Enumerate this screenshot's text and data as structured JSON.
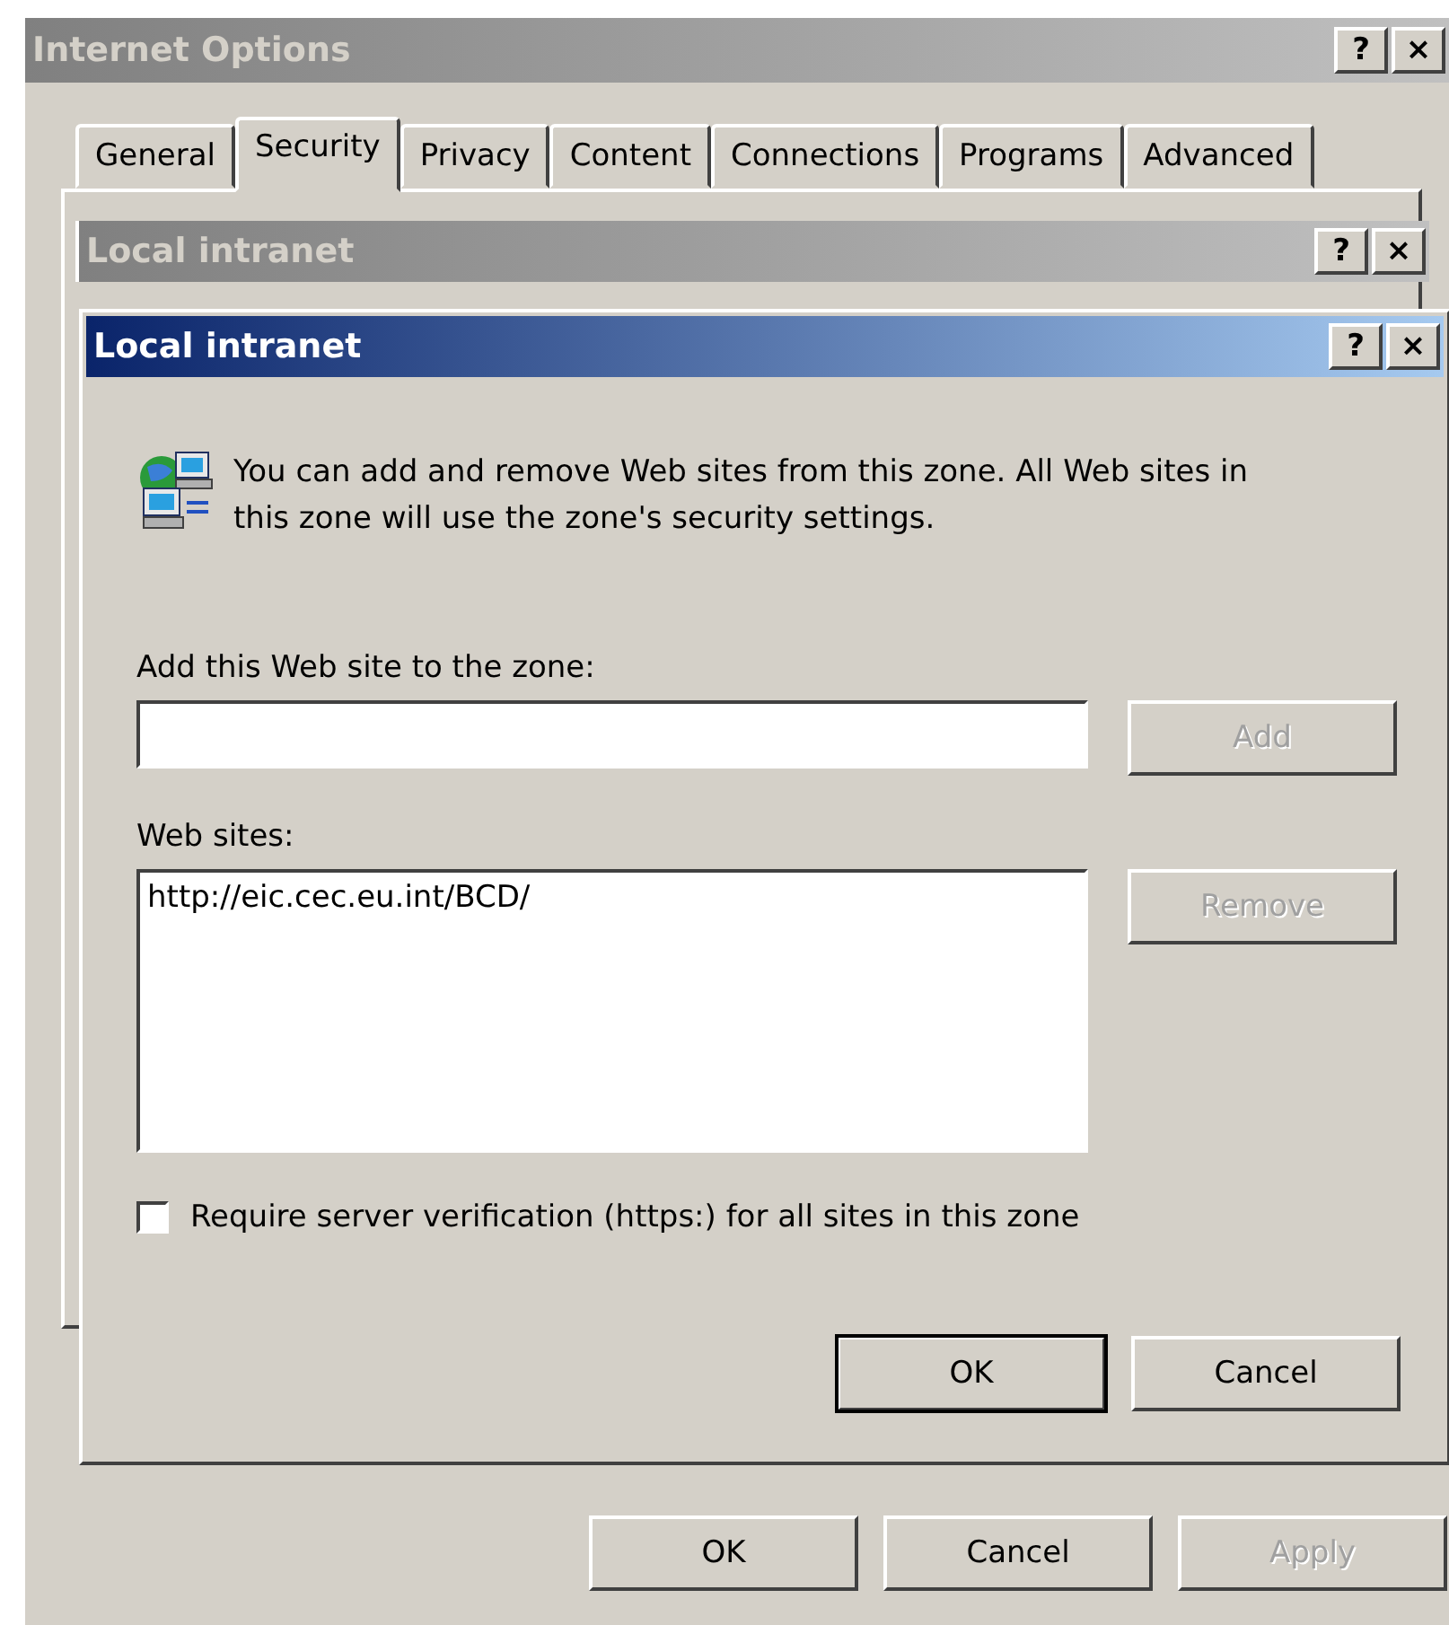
{
  "window": {
    "title": "Internet Options",
    "active": false,
    "controls": [
      "?",
      "×"
    ]
  },
  "tabs": [
    {
      "label": "General",
      "selected": false
    },
    {
      "label": "Security",
      "selected": true
    },
    {
      "label": "Privacy",
      "selected": false
    },
    {
      "label": "Content",
      "selected": false
    },
    {
      "label": "Connections",
      "selected": false
    },
    {
      "label": "Programs",
      "selected": false
    },
    {
      "label": "Advanced",
      "selected": false
    }
  ],
  "back_dialog": {
    "title": "Local intranet",
    "active": false,
    "controls": [
      "?",
      "×"
    ]
  },
  "dialog": {
    "title": "Local intranet",
    "active": true,
    "controls": [
      "?",
      "×"
    ],
    "description": "You can add and remove Web sites from this zone. All Web sites in this zone will use the zone's security settings.",
    "add_label": "Add this Web site to the zone:",
    "add_button": {
      "label": "Add",
      "disabled": true,
      "default": false
    },
    "sites_label": "Web sites:",
    "sites": [
      {
        "text": "http://eic.cec.eu.int/BCD/",
        "selected": false
      }
    ],
    "remove_button": {
      "label": "Remove",
      "disabled": true,
      "default": false
    },
    "checkbox": {
      "label": "Require server verification (https:) for all sites in this zone",
      "checked": false
    },
    "buttons": [
      {
        "label": "OK",
        "disabled": false,
        "default": true
      },
      {
        "label": "Cancel",
        "disabled": false,
        "default": false
      }
    ]
  },
  "buttons": [
    {
      "label": "OK",
      "disabled": false,
      "default": false
    },
    {
      "label": "Cancel",
      "disabled": false,
      "default": false
    },
    {
      "label": "Apply",
      "disabled": true,
      "default": false
    }
  ]
}
